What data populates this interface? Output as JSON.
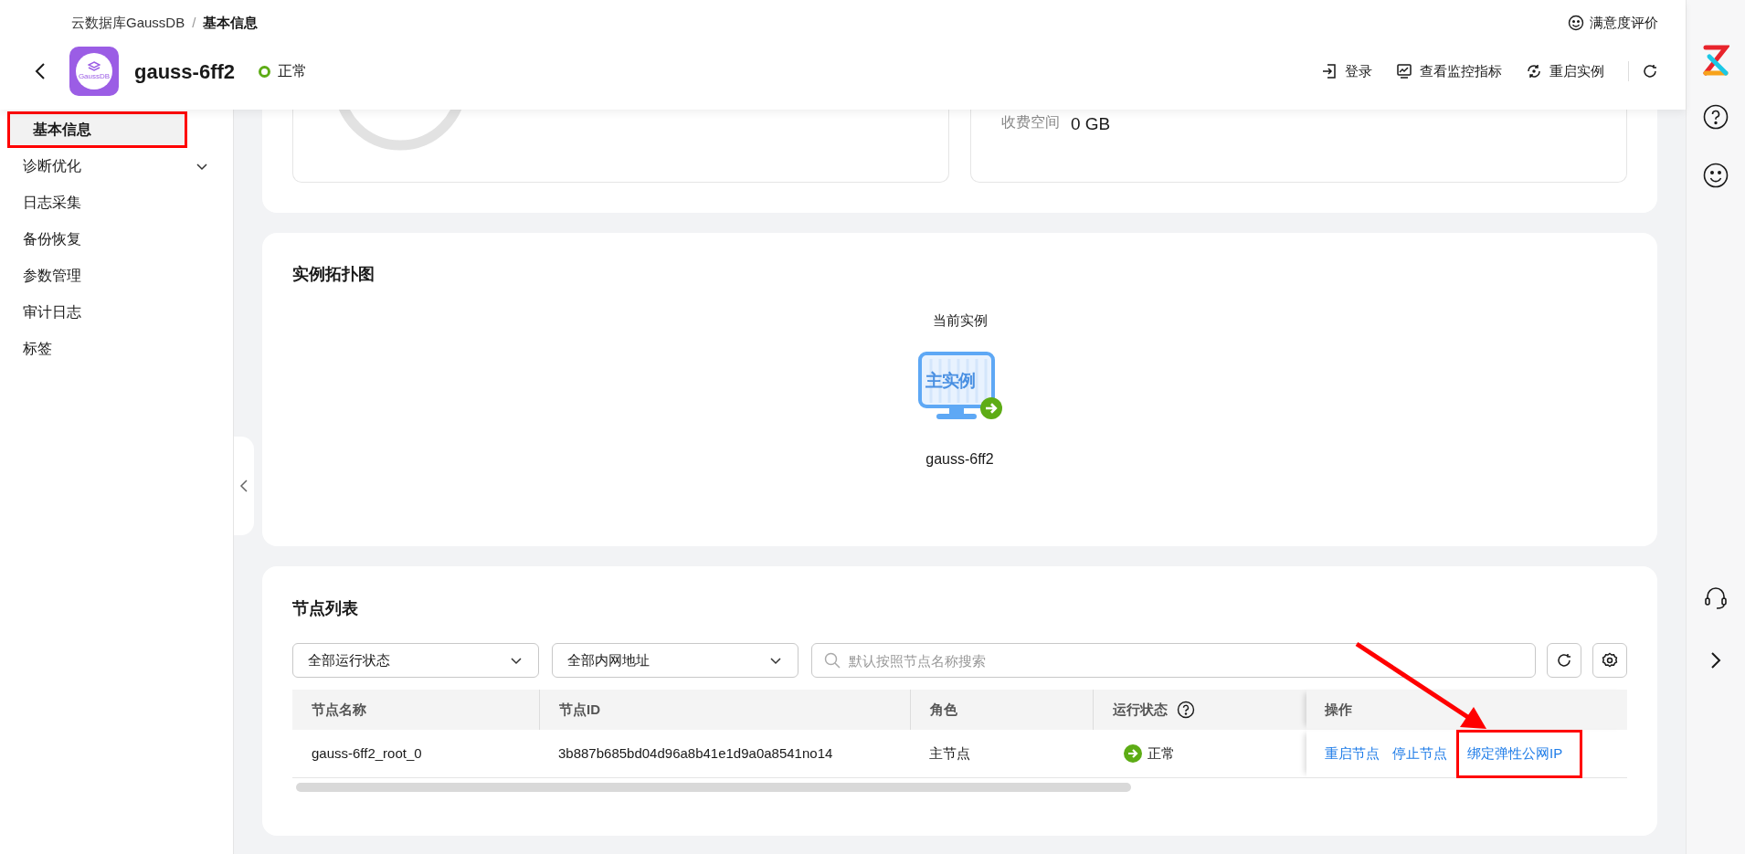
{
  "breadcrumb": {
    "separator": "/",
    "items": [
      {
        "label": "云数据库GaussDB",
        "current": false
      },
      {
        "label": "基本信息",
        "current": true
      }
    ]
  },
  "feedback": {
    "label": "满意度评价"
  },
  "instance": {
    "logo_text": "GaussDB",
    "name": "gauss-6ff2",
    "status": "正常"
  },
  "actions": [
    {
      "kind": "login",
      "label": "登录"
    },
    {
      "kind": "monitor",
      "label": "查看监控指标"
    },
    {
      "kind": "restart",
      "label": "重启实例"
    }
  ],
  "sidebar": {
    "items": [
      {
        "label": "基本信息",
        "selected": true,
        "highlighted": true
      },
      {
        "label": "诊断优化",
        "selected": false,
        "highlighted": false,
        "expanded": false
      },
      {
        "label": "日志采集",
        "selected": false,
        "highlighted": false
      },
      {
        "label": "备份恢复",
        "selected": false,
        "highlighted": false
      },
      {
        "label": "参数管理",
        "selected": false,
        "highlighted": false
      },
      {
        "label": "审计日志",
        "selected": false,
        "highlighted": false
      },
      {
        "label": "标签",
        "selected": false,
        "highlighted": false
      }
    ]
  },
  "storage": {
    "charge_label": "收费空间",
    "charge_value": "0 GB"
  },
  "topology": {
    "title": "实例拓扑图",
    "caption": "当前实例",
    "node": {
      "badge": "主实例",
      "name": "gauss-6ff2"
    }
  },
  "nodes": {
    "title": "节点列表",
    "filters": [
      {
        "value": "全部运行状态"
      },
      {
        "value": "全部内网地址"
      }
    ],
    "search": {
      "placeholder": "默认按照节点名称搜索"
    },
    "table": {
      "columns": [
        {
          "label": "节点名称",
          "help": false
        },
        {
          "label": "节点ID",
          "help": false
        },
        {
          "label": "角色",
          "help": false
        },
        {
          "label": "运行状态",
          "help": true
        },
        {
          "label": "操作",
          "help": false
        }
      ],
      "rows": [
        {
          "cells": [
            "gauss-6ff2_root_0",
            "3b887b685bd04d96a8b41e1d9a0a8541no14",
            "主节点"
          ],
          "status": "正常",
          "actions": [
            {
              "label": "重启节点",
              "highlighted": false
            },
            {
              "label": "停止节点",
              "highlighted": false
            },
            {
              "label": "绑定弹性公网IP",
              "highlighted": true
            }
          ]
        }
      ]
    }
  }
}
